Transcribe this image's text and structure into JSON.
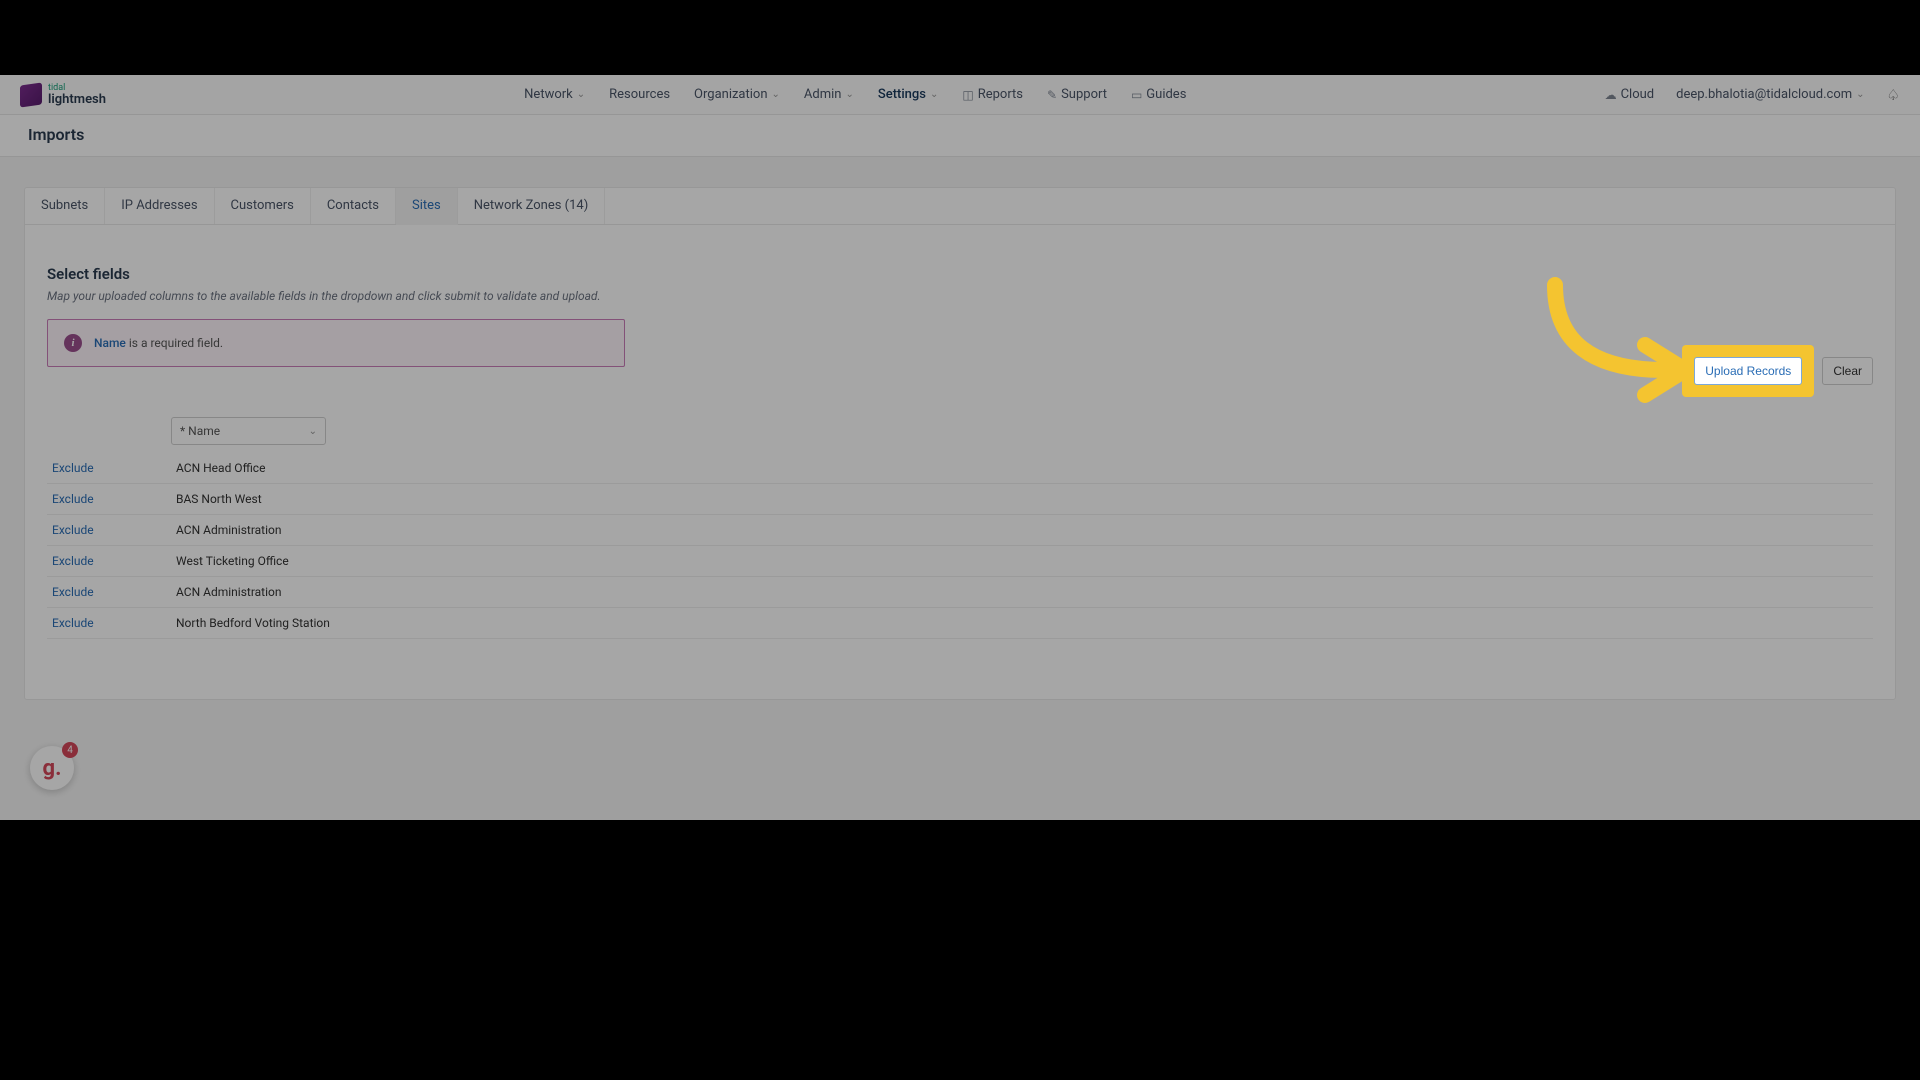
{
  "logo": {
    "tidal": "tidal",
    "light": "lightmesh"
  },
  "nav": {
    "network": "Network",
    "resources": "Resources",
    "organization": "Organization",
    "admin": "Admin",
    "settings": "Settings",
    "reports": "Reports",
    "support": "Support",
    "guides": "Guides",
    "cloud": "Cloud",
    "user": "deep.bhalotia@tidalcloud.com"
  },
  "page_title": "Imports",
  "tabs": {
    "subnets": "Subnets",
    "ip_addresses": "IP Addresses",
    "customers": "Customers",
    "contacts": "Contacts",
    "sites": "Sites",
    "network_zones": "Network Zones (14)"
  },
  "section": {
    "title": "Select fields",
    "desc": "Map your uploaded columns to the available fields in the dropdown and click submit to validate and upload.",
    "notice_bold": "Name",
    "notice_rest": " is a required field."
  },
  "buttons": {
    "upload": "Upload Records",
    "clear": "Clear",
    "exclude": "Exclude"
  },
  "field_select": "* Name",
  "rows": [
    "ACN Head Office",
    "BAS North West",
    "ACN Administration",
    "West Ticketing Office",
    "ACN Administration",
    "North Bedford Voting Station"
  ],
  "widget_badge": "4"
}
